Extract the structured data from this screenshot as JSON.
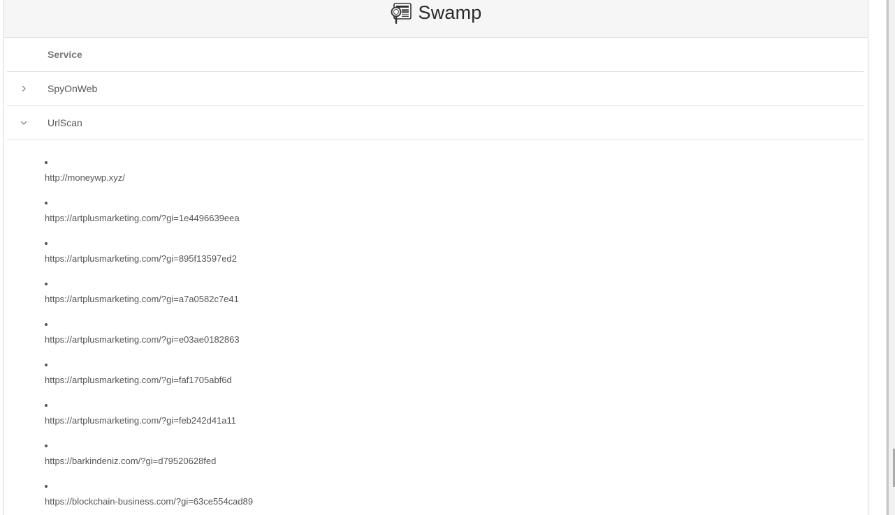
{
  "app": {
    "title": "Swamp",
    "logo_icon": "magnifier-document-icon"
  },
  "table": {
    "header": {
      "service_label": "Service"
    },
    "rows": [
      {
        "label": "SpyOnWeb",
        "expanded": false,
        "chevron_icon": "chevron-right-icon"
      },
      {
        "label": "UrlScan",
        "expanded": true,
        "chevron_icon": "chevron-down-icon"
      }
    ]
  },
  "urlscan": {
    "urls": [
      "http://moneywp.xyz/",
      "https://artplusmarketing.com/?gi=1e4496639eea",
      "https://artplusmarketing.com/?gi=895f13597ed2",
      "https://artplusmarketing.com/?gi=a7a0582c7e41",
      "https://artplusmarketing.com/?gi=e03ae0182863",
      "https://artplusmarketing.com/?gi=faf1705abf6d",
      "https://artplusmarketing.com/?gi=feb242d41a11",
      "https://barkindeniz.com/?gi=d79520628fed",
      "https://blockchain-business.com/?gi=63ce554cad89"
    ]
  },
  "colors": {
    "header_bg": "#f6f6f6",
    "border": "#e3e3e3",
    "text": "#555555"
  }
}
